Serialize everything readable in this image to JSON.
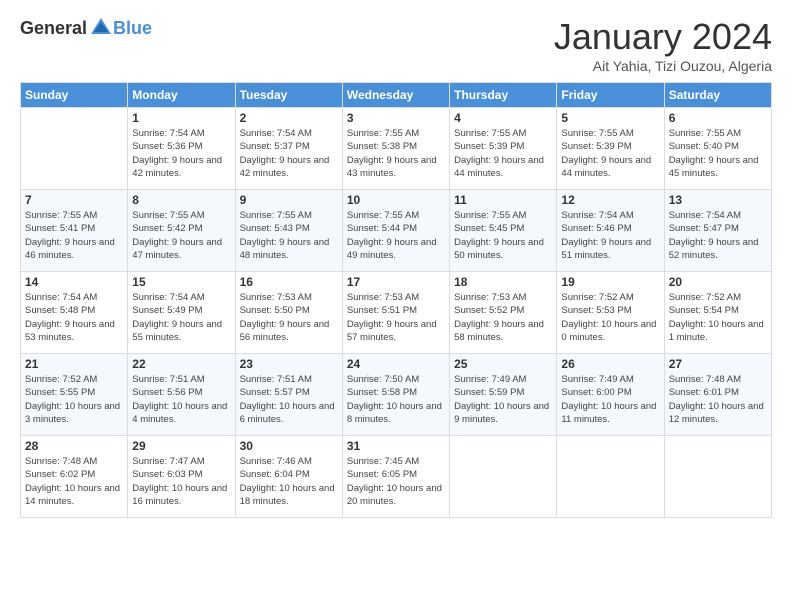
{
  "logo": {
    "text_general": "General",
    "text_blue": "Blue"
  },
  "header": {
    "month": "January 2024",
    "location": "Ait Yahia, Tizi Ouzou, Algeria"
  },
  "weekdays": [
    "Sunday",
    "Monday",
    "Tuesday",
    "Wednesday",
    "Thursday",
    "Friday",
    "Saturday"
  ],
  "weeks": [
    [
      {
        "day": "",
        "sunrise": "",
        "sunset": "",
        "daylight": ""
      },
      {
        "day": "1",
        "sunrise": "Sunrise: 7:54 AM",
        "sunset": "Sunset: 5:36 PM",
        "daylight": "Daylight: 9 hours and 42 minutes."
      },
      {
        "day": "2",
        "sunrise": "Sunrise: 7:54 AM",
        "sunset": "Sunset: 5:37 PM",
        "daylight": "Daylight: 9 hours and 42 minutes."
      },
      {
        "day": "3",
        "sunrise": "Sunrise: 7:55 AM",
        "sunset": "Sunset: 5:38 PM",
        "daylight": "Daylight: 9 hours and 43 minutes."
      },
      {
        "day": "4",
        "sunrise": "Sunrise: 7:55 AM",
        "sunset": "Sunset: 5:39 PM",
        "daylight": "Daylight: 9 hours and 44 minutes."
      },
      {
        "day": "5",
        "sunrise": "Sunrise: 7:55 AM",
        "sunset": "Sunset: 5:39 PM",
        "daylight": "Daylight: 9 hours and 44 minutes."
      },
      {
        "day": "6",
        "sunrise": "Sunrise: 7:55 AM",
        "sunset": "Sunset: 5:40 PM",
        "daylight": "Daylight: 9 hours and 45 minutes."
      }
    ],
    [
      {
        "day": "7",
        "sunrise": "Sunrise: 7:55 AM",
        "sunset": "Sunset: 5:41 PM",
        "daylight": "Daylight: 9 hours and 46 minutes."
      },
      {
        "day": "8",
        "sunrise": "Sunrise: 7:55 AM",
        "sunset": "Sunset: 5:42 PM",
        "daylight": "Daylight: 9 hours and 47 minutes."
      },
      {
        "day": "9",
        "sunrise": "Sunrise: 7:55 AM",
        "sunset": "Sunset: 5:43 PM",
        "daylight": "Daylight: 9 hours and 48 minutes."
      },
      {
        "day": "10",
        "sunrise": "Sunrise: 7:55 AM",
        "sunset": "Sunset: 5:44 PM",
        "daylight": "Daylight: 9 hours and 49 minutes."
      },
      {
        "day": "11",
        "sunrise": "Sunrise: 7:55 AM",
        "sunset": "Sunset: 5:45 PM",
        "daylight": "Daylight: 9 hours and 50 minutes."
      },
      {
        "day": "12",
        "sunrise": "Sunrise: 7:54 AM",
        "sunset": "Sunset: 5:46 PM",
        "daylight": "Daylight: 9 hours and 51 minutes."
      },
      {
        "day": "13",
        "sunrise": "Sunrise: 7:54 AM",
        "sunset": "Sunset: 5:47 PM",
        "daylight": "Daylight: 9 hours and 52 minutes."
      }
    ],
    [
      {
        "day": "14",
        "sunrise": "Sunrise: 7:54 AM",
        "sunset": "Sunset: 5:48 PM",
        "daylight": "Daylight: 9 hours and 53 minutes."
      },
      {
        "day": "15",
        "sunrise": "Sunrise: 7:54 AM",
        "sunset": "Sunset: 5:49 PM",
        "daylight": "Daylight: 9 hours and 55 minutes."
      },
      {
        "day": "16",
        "sunrise": "Sunrise: 7:53 AM",
        "sunset": "Sunset: 5:50 PM",
        "daylight": "Daylight: 9 hours and 56 minutes."
      },
      {
        "day": "17",
        "sunrise": "Sunrise: 7:53 AM",
        "sunset": "Sunset: 5:51 PM",
        "daylight": "Daylight: 9 hours and 57 minutes."
      },
      {
        "day": "18",
        "sunrise": "Sunrise: 7:53 AM",
        "sunset": "Sunset: 5:52 PM",
        "daylight": "Daylight: 9 hours and 58 minutes."
      },
      {
        "day": "19",
        "sunrise": "Sunrise: 7:52 AM",
        "sunset": "Sunset: 5:53 PM",
        "daylight": "Daylight: 10 hours and 0 minutes."
      },
      {
        "day": "20",
        "sunrise": "Sunrise: 7:52 AM",
        "sunset": "Sunset: 5:54 PM",
        "daylight": "Daylight: 10 hours and 1 minute."
      }
    ],
    [
      {
        "day": "21",
        "sunrise": "Sunrise: 7:52 AM",
        "sunset": "Sunset: 5:55 PM",
        "daylight": "Daylight: 10 hours and 3 minutes."
      },
      {
        "day": "22",
        "sunrise": "Sunrise: 7:51 AM",
        "sunset": "Sunset: 5:56 PM",
        "daylight": "Daylight: 10 hours and 4 minutes."
      },
      {
        "day": "23",
        "sunrise": "Sunrise: 7:51 AM",
        "sunset": "Sunset: 5:57 PM",
        "daylight": "Daylight: 10 hours and 6 minutes."
      },
      {
        "day": "24",
        "sunrise": "Sunrise: 7:50 AM",
        "sunset": "Sunset: 5:58 PM",
        "daylight": "Daylight: 10 hours and 8 minutes."
      },
      {
        "day": "25",
        "sunrise": "Sunrise: 7:49 AM",
        "sunset": "Sunset: 5:59 PM",
        "daylight": "Daylight: 10 hours and 9 minutes."
      },
      {
        "day": "26",
        "sunrise": "Sunrise: 7:49 AM",
        "sunset": "Sunset: 6:00 PM",
        "daylight": "Daylight: 10 hours and 11 minutes."
      },
      {
        "day": "27",
        "sunrise": "Sunrise: 7:48 AM",
        "sunset": "Sunset: 6:01 PM",
        "daylight": "Daylight: 10 hours and 12 minutes."
      }
    ],
    [
      {
        "day": "28",
        "sunrise": "Sunrise: 7:48 AM",
        "sunset": "Sunset: 6:02 PM",
        "daylight": "Daylight: 10 hours and 14 minutes."
      },
      {
        "day": "29",
        "sunrise": "Sunrise: 7:47 AM",
        "sunset": "Sunset: 6:03 PM",
        "daylight": "Daylight: 10 hours and 16 minutes."
      },
      {
        "day": "30",
        "sunrise": "Sunrise: 7:46 AM",
        "sunset": "Sunset: 6:04 PM",
        "daylight": "Daylight: 10 hours and 18 minutes."
      },
      {
        "day": "31",
        "sunrise": "Sunrise: 7:45 AM",
        "sunset": "Sunset: 6:05 PM",
        "daylight": "Daylight: 10 hours and 20 minutes."
      },
      {
        "day": "",
        "sunrise": "",
        "sunset": "",
        "daylight": ""
      },
      {
        "day": "",
        "sunrise": "",
        "sunset": "",
        "daylight": ""
      },
      {
        "day": "",
        "sunrise": "",
        "sunset": "",
        "daylight": ""
      }
    ]
  ]
}
